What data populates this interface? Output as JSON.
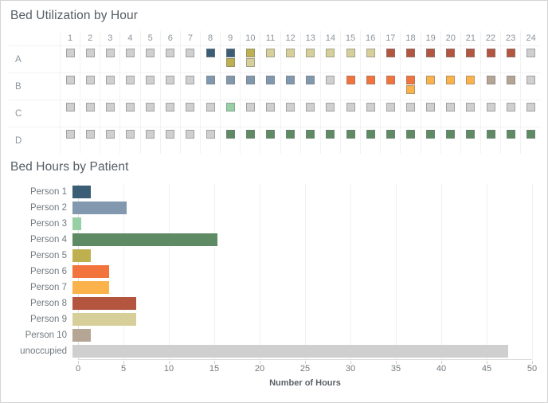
{
  "panels": {
    "grid": {
      "title": "Bed Utilization by Hour"
    },
    "bars": {
      "title": "Bed Hours by Patient"
    }
  },
  "colors": {
    "person1": "#3c5d76",
    "person2": "#8298ae",
    "person3": "#98d0a5",
    "person4": "#5e8a64",
    "person5": "#bfb04f",
    "person6": "#f2733b",
    "person7": "#fbb24a",
    "person8": "#b4563f",
    "person9": "#d7cf9a",
    "person10": "#b5a595",
    "unoccupied": "#cfcfcf",
    "mark_border": "#7b8085",
    "panel_border": "#d4d4d4",
    "title_text": "#555c63",
    "label_text": "#8d949b",
    "gridline": "#f2f2f2"
  },
  "chart_data": [
    {
      "type": "heatmap",
      "title": "Bed Utilization by Hour",
      "xlabel": "",
      "ylabel": "",
      "grid": true,
      "legend": "none",
      "x_categories": [
        "1",
        "2",
        "3",
        "4",
        "5",
        "6",
        "7",
        "8",
        "9",
        "10",
        "11",
        "12",
        "13",
        "14",
        "15",
        "16",
        "17",
        "18",
        "19",
        "20",
        "21",
        "22",
        "23",
        "24"
      ],
      "y_categories": [
        "A",
        "B",
        "C",
        "D"
      ],
      "note": "each cell holds one or two stacked square marks; colour encodes the patient occupying the bed that hour, light grey = unoccupied",
      "cells": {
        "A": [
          [
            "unoccupied"
          ],
          [
            "unoccupied"
          ],
          [
            "unoccupied"
          ],
          [
            "unoccupied"
          ],
          [
            "unoccupied"
          ],
          [
            "unoccupied"
          ],
          [
            "unoccupied"
          ],
          [
            "person1"
          ],
          [
            "person1",
            "person5"
          ],
          [
            "person5",
            "person9"
          ],
          [
            "person9"
          ],
          [
            "person9"
          ],
          [
            "person9"
          ],
          [
            "person9"
          ],
          [
            "person9"
          ],
          [
            "person9"
          ],
          [
            "person8"
          ],
          [
            "person8"
          ],
          [
            "person8"
          ],
          [
            "person8"
          ],
          [
            "person8"
          ],
          [
            "person8"
          ],
          [
            "person8"
          ],
          [
            "unoccupied"
          ]
        ],
        "B": [
          [
            "unoccupied"
          ],
          [
            "unoccupied"
          ],
          [
            "unoccupied"
          ],
          [
            "unoccupied"
          ],
          [
            "unoccupied"
          ],
          [
            "unoccupied"
          ],
          [
            "unoccupied"
          ],
          [
            "person2"
          ],
          [
            "person2"
          ],
          [
            "person2"
          ],
          [
            "person2"
          ],
          [
            "person2"
          ],
          [
            "person2"
          ],
          [
            "unoccupied"
          ],
          [
            "person6"
          ],
          [
            "person6"
          ],
          [
            "person6"
          ],
          [
            "person6",
            "person7"
          ],
          [
            "person7"
          ],
          [
            "person7"
          ],
          [
            "person7"
          ],
          [
            "person10"
          ],
          [
            "person10"
          ],
          [
            "unoccupied"
          ]
        ],
        "C": [
          [
            "unoccupied"
          ],
          [
            "unoccupied"
          ],
          [
            "unoccupied"
          ],
          [
            "unoccupied"
          ],
          [
            "unoccupied"
          ],
          [
            "unoccupied"
          ],
          [
            "unoccupied"
          ],
          [
            "unoccupied"
          ],
          [
            "person3"
          ],
          [
            "unoccupied"
          ],
          [
            "unoccupied"
          ],
          [
            "unoccupied"
          ],
          [
            "unoccupied"
          ],
          [
            "unoccupied"
          ],
          [
            "unoccupied"
          ],
          [
            "unoccupied"
          ],
          [
            "unoccupied"
          ],
          [
            "unoccupied"
          ],
          [
            "unoccupied"
          ],
          [
            "unoccupied"
          ],
          [
            "unoccupied"
          ],
          [
            "unoccupied"
          ],
          [
            "unoccupied"
          ],
          [
            "unoccupied"
          ]
        ],
        "D": [
          [
            "unoccupied"
          ],
          [
            "unoccupied"
          ],
          [
            "unoccupied"
          ],
          [
            "unoccupied"
          ],
          [
            "unoccupied"
          ],
          [
            "unoccupied"
          ],
          [
            "unoccupied"
          ],
          [
            "unoccupied"
          ],
          [
            "person4"
          ],
          [
            "person4"
          ],
          [
            "person4"
          ],
          [
            "person4"
          ],
          [
            "person4"
          ],
          [
            "person4"
          ],
          [
            "person4"
          ],
          [
            "person4"
          ],
          [
            "person4"
          ],
          [
            "person4"
          ],
          [
            "person4"
          ],
          [
            "person4"
          ],
          [
            "person4"
          ],
          [
            "person4"
          ],
          [
            "person4"
          ],
          [
            "person4"
          ]
        ]
      }
    },
    {
      "type": "bar",
      "orientation": "horizontal",
      "title": "Bed Hours by Patient",
      "xlabel": "Number of Hours",
      "ylabel": "",
      "xlim": [
        0,
        50
      ],
      "xticks": [
        0,
        5,
        10,
        15,
        20,
        25,
        30,
        35,
        40,
        45,
        50
      ],
      "grid": true,
      "legend": "none",
      "categories": [
        "Person 1",
        "Person 2",
        "Person 3",
        "Person 4",
        "Person 5",
        "Person 6",
        "Person 7",
        "Person 8",
        "Person 9",
        "Person 10",
        "unoccupied"
      ],
      "values": [
        2,
        6,
        1,
        16,
        2,
        4,
        4,
        7,
        7,
        2,
        48
      ],
      "bar_colors": [
        "person1",
        "person2",
        "person3",
        "person4",
        "person5",
        "person6",
        "person7",
        "person8",
        "person9",
        "person10",
        "unoccupied"
      ]
    }
  ]
}
